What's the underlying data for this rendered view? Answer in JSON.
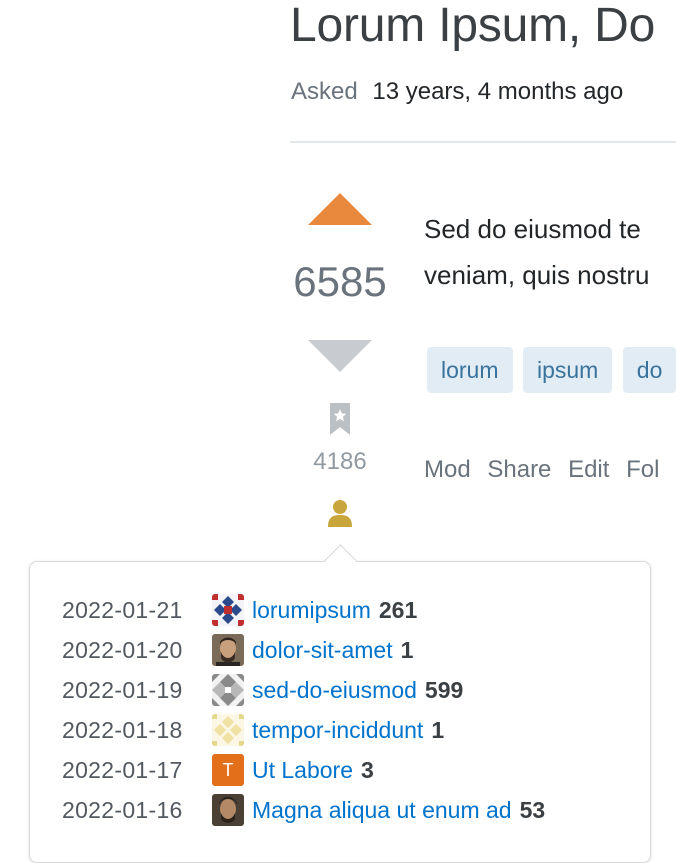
{
  "question": {
    "title": "Lorum Ipsum, Do",
    "asked_label": "Asked",
    "asked_value": "13 years, 4 months ago",
    "score": "6585",
    "bookmark_count": "4186",
    "body_lines": [
      "Sed do eiusmod te",
      "veniam, quis nostru"
    ],
    "tags": [
      "lorum",
      "ipsum",
      "do"
    ],
    "actions": [
      "Mod",
      "Share",
      "Edit",
      "Fol"
    ]
  },
  "colors": {
    "upvote": "#e8893e",
    "downvote": "#c8ccd0",
    "link": "#0074cc",
    "tag_bg": "#e1ecf4",
    "tag_text": "#39739d",
    "user_icon": "#c9a63b"
  },
  "bookmark_history": [
    {
      "date": "2022-01-21",
      "user": "lorumipsum",
      "rep": "261",
      "avatar": "identicon-red-blue"
    },
    {
      "date": "2022-01-20",
      "user": "dolor-sit-amet",
      "rep": "1",
      "avatar": "photo-avatar"
    },
    {
      "date": "2022-01-19",
      "user": "sed-do-eiusmod",
      "rep": "599",
      "avatar": "identicon-gray"
    },
    {
      "date": "2022-01-18",
      "user": "tempor-inciddunt",
      "rep": "1",
      "avatar": "identicon-yellow"
    },
    {
      "date": "2022-01-17",
      "user": "Ut Labore",
      "rep": "3",
      "avatar": "letter-avatar",
      "avatar_letter": "T"
    },
    {
      "date": "2022-01-16",
      "user": "Magna aliqua ut enum ad",
      "rep": "53",
      "avatar": "photo-avatar"
    }
  ]
}
